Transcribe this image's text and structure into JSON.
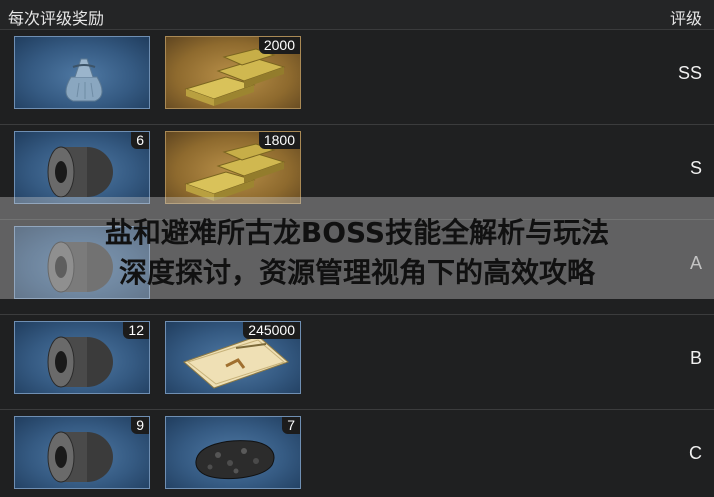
{
  "header": {
    "title": "每次评级奖励",
    "grade_column": "评级"
  },
  "rows": [
    {
      "grade": "SS",
      "items": [
        {
          "icon": "cloth-bag-icon",
          "count": ""
        },
        {
          "icon": "gold-bars-icon",
          "count": "2000"
        }
      ]
    },
    {
      "grade": "S",
      "items": [
        {
          "icon": "tape-roll-icon",
          "count": "6"
        },
        {
          "icon": "gold-bars-icon",
          "count": "1800"
        }
      ]
    },
    {
      "grade": "A",
      "items": [
        {
          "icon": "tape-roll-icon",
          "count": ""
        }
      ]
    },
    {
      "grade": "B",
      "items": [
        {
          "icon": "tape-roll-icon",
          "count": "12"
        },
        {
          "icon": "card-envelope-icon",
          "count": "245000"
        }
      ]
    },
    {
      "grade": "C",
      "items": [
        {
          "icon": "tape-roll-icon",
          "count": "9"
        },
        {
          "icon": "ore-chunk-icon",
          "count": "7"
        }
      ]
    }
  ],
  "overlay": {
    "line1": "盐和避难所古龙BOSS技能全解析与玩法",
    "line2": "深度探讨，资源管理视角下的高效攻略"
  }
}
